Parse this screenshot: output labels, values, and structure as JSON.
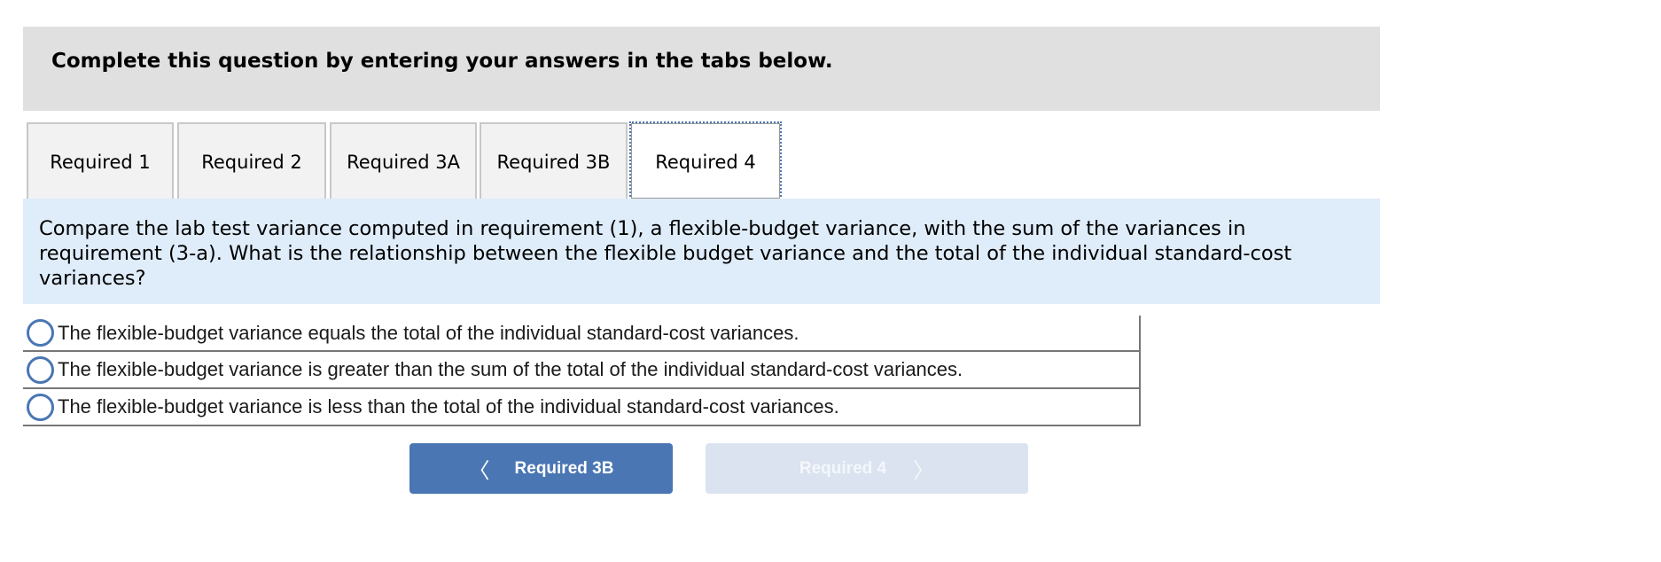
{
  "instructions": {
    "text": "Complete this question by entering your answers in the tabs below."
  },
  "tabs": [
    {
      "label": "Required 1",
      "active": false
    },
    {
      "label": "Required 2",
      "active": false
    },
    {
      "label": "Required 3A",
      "active": false
    },
    {
      "label": "Required 3B",
      "active": false
    },
    {
      "label": "Required 4",
      "active": true
    }
  ],
  "question": {
    "text": "Compare the lab test variance computed in requirement (1), a flexible-budget variance, with the sum of the variances in requirement (3-a). What is the relationship between the flexible budget variance and the total of the individual standard-cost variances?"
  },
  "options": [
    {
      "label": "The flexible-budget variance equals the total of the individual standard-cost variances.",
      "selected": false
    },
    {
      "label": "The flexible-budget variance is greater than the sum of the total of the individual standard-cost variances.",
      "selected": false
    },
    {
      "label": "The flexible-budget variance is less than the total of the individual standard-cost variances.",
      "selected": false
    }
  ],
  "navigation": {
    "prev_label": "Required 3B",
    "prev_icon": "chevron-left-icon",
    "next_label": "Required 4",
    "next_icon": "chevron-right-icon",
    "next_disabled": true
  },
  "colors": {
    "accent": "#4a76b4",
    "question_bg": "#dfecf9",
    "instructions_bg": "#e0e0e0",
    "disabled_button_bg": "#dae3ef"
  }
}
